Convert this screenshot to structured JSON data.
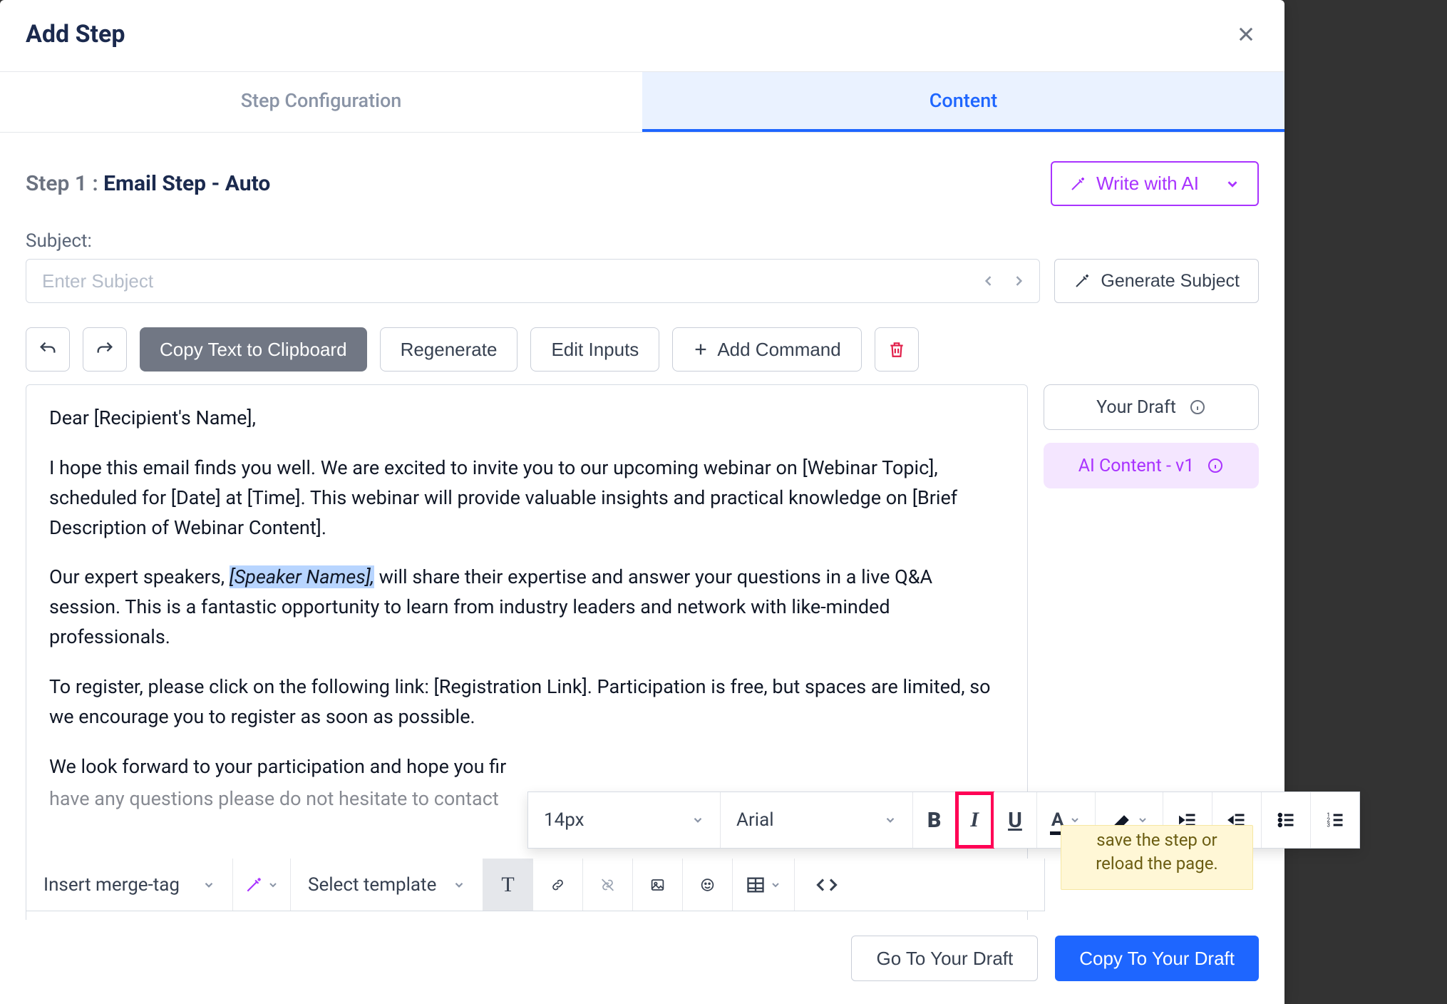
{
  "modal": {
    "title": "Add Step"
  },
  "tabs": {
    "config": "Step Configuration",
    "content": "Content"
  },
  "step": {
    "prefix": "Step 1 : ",
    "name": "Email Step - Auto"
  },
  "writeAI": {
    "label": "Write with AI"
  },
  "subject": {
    "label": "Subject:",
    "placeholder": "Enter Subject",
    "value": ""
  },
  "generateSubject": {
    "label": "Generate Subject"
  },
  "actions": {
    "copyClipboard": "Copy Text to Clipboard",
    "regenerate": "Regenerate",
    "editInputs": "Edit Inputs",
    "addCommand": "Add Command"
  },
  "editor": {
    "p1": "Dear [Recipient's Name],",
    "p2": "I hope this email finds you well. We are excited to invite you to our upcoming webinar on [Webinar Topic], scheduled for [Date] at [Time]. This webinar will provide valuable insights and practical knowledge on [Brief Description of Webinar Content].",
    "p3a": "Our expert speakers, ",
    "p3_sel": "[Speaker Names],",
    "p3b": " will share their expertise and answer your questions in a live Q&A session. This is a fantastic opportunity to learn from industry leaders and network with like-minded professionals.",
    "p4": "To register, please click on the following link: [Registration Link]. Participation is free, but spaces are limited, so we encourage you to register as soon as possible.",
    "p5": "We look forward to your participation and hope you fir",
    "p6": "have any questions  please do not hesitate to contact"
  },
  "side": {
    "draft": "Your Draft",
    "ai": "AI Content - v1"
  },
  "floatToolbar": {
    "fontSize": "14px",
    "fontFamily": "Arial"
  },
  "bottomToolbar": {
    "merge": "Insert merge-tag",
    "template": "Select template"
  },
  "note": {
    "line1": "save the step or",
    "line2": "reload the page."
  },
  "footer": {
    "goDraft": "Go To Your Draft",
    "copyDraft": "Copy To Your Draft"
  }
}
